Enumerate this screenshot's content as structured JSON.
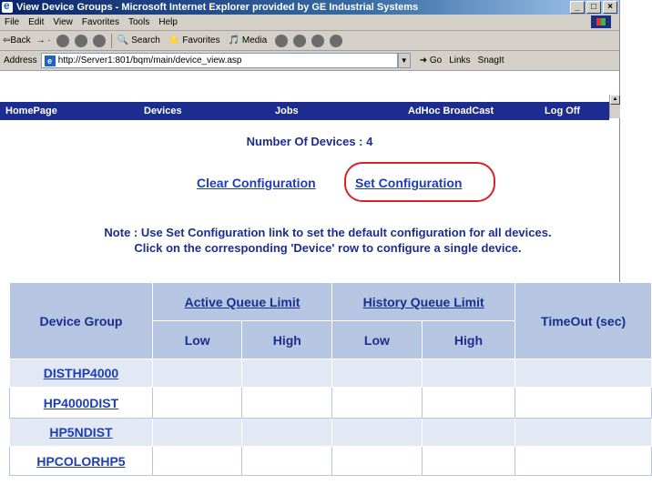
{
  "window": {
    "title": "View Device Groups - Microsoft Internet Explorer provided by GE Industrial Systems",
    "controls": [
      "_",
      "□",
      "×"
    ]
  },
  "menu": [
    "File",
    "Edit",
    "View",
    "Favorites",
    "Tools",
    "Help"
  ],
  "toolbar": {
    "back": "⇦Back",
    "search": "Search",
    "favorites": "Favorites",
    "media": "Media"
  },
  "address": {
    "label": "Address",
    "url": "http://Server1:801/bqm/main/device_view.asp",
    "go": "Go",
    "links": "Links",
    "snagit": "SnagIt"
  },
  "nav": {
    "items": [
      "HomePage",
      "Devices",
      "Jobs",
      "AdHoc BroadCast",
      "Log Off"
    ]
  },
  "page": {
    "device_count": "Number Of Devices : 4",
    "clear_config": "Clear Configuration",
    "set_config": "Set Configuration",
    "note_line1": "Note : Use Set Configuration link to set the default configuration for all devices.",
    "note_line2": "Click on the corresponding 'Device' row to configure a single device."
  },
  "table": {
    "col_device_group": "Device Group",
    "col_active_queue": "Active Queue Limit",
    "col_history_queue": "History Queue Limit",
    "col_timeout": "TimeOut (sec)",
    "sub_low": "Low",
    "sub_high": "High",
    "rows": [
      {
        "name": "DISTHP4000"
      },
      {
        "name": "HP4000DIST"
      },
      {
        "name": "HP5NDIST"
      },
      {
        "name": "HPCOLORHP5"
      }
    ]
  },
  "colors": {
    "nav_bg": "#1d2d8f",
    "header_bg": "#b6c6e2",
    "row_alt_bg": "#e2e8f4",
    "highlight_ring": "#d8222a"
  }
}
